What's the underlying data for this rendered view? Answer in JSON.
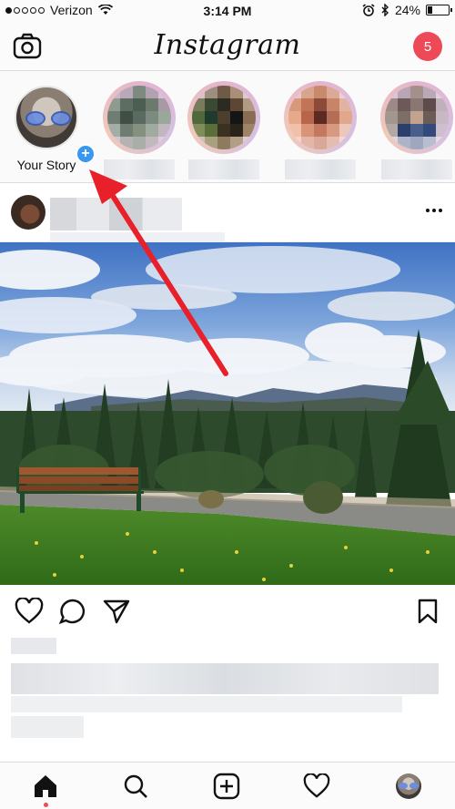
{
  "status_bar": {
    "carrier": "Verizon",
    "time": "3:14 PM",
    "battery": "24%",
    "battery_level": 0.24,
    "signal_bars_filled": 1,
    "signal_bars_total": 5
  },
  "header": {
    "title": "Instagram",
    "notification_count": "5",
    "badge_color": "#ed4956"
  },
  "stories": {
    "your_story_label": "Your Story",
    "plus_color": "#3897f0",
    "items_count_visible": 4
  },
  "post": {
    "icons": [
      "heart-icon",
      "comment-icon",
      "share-icon",
      "bookmark-icon"
    ]
  },
  "tab_bar": {
    "items": [
      "home-icon",
      "search-icon",
      "add-post-icon",
      "activity-heart-icon",
      "profile-avatar"
    ]
  },
  "annotation": {
    "arrow_color": "#e8202a"
  }
}
